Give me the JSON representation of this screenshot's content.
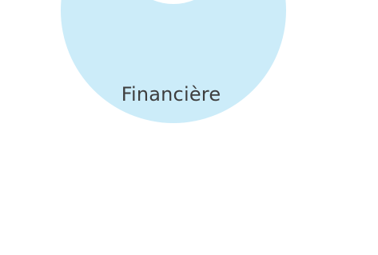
{
  "category": {
    "label": "Financière",
    "icon": "ring-icon",
    "accent_color": "#ccecf9"
  }
}
